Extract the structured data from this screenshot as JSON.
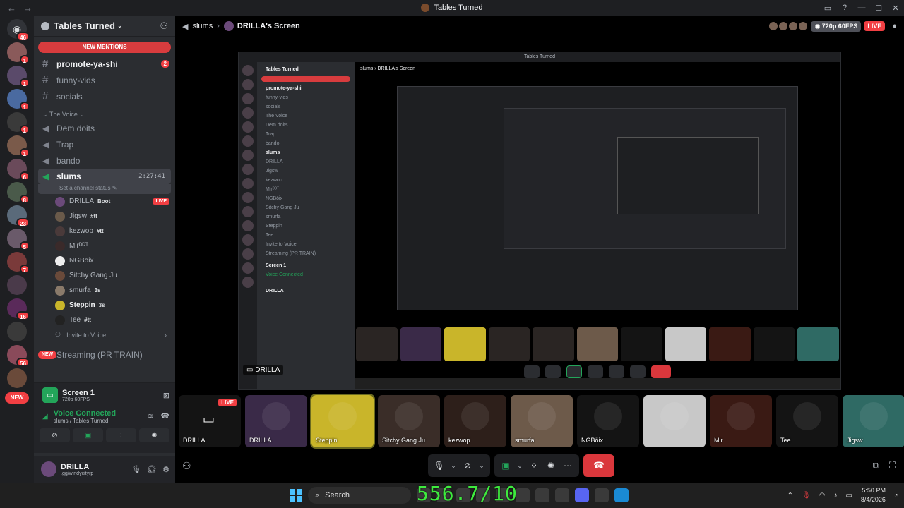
{
  "window": {
    "title": "Tables Turned",
    "back_icon": "arrow-left",
    "forward_icon": "arrow-right"
  },
  "rail": {
    "home_badge": "46",
    "servers": [
      {
        "badge": "1"
      },
      {
        "badge": "1"
      },
      {
        "badge": "1"
      },
      {
        "badge": "1"
      },
      {
        "badge": "1"
      },
      {
        "badge": "6"
      },
      {
        "badge": "8"
      },
      {
        "badge": "23"
      },
      {
        "badge": "5"
      },
      {
        "badge": "7"
      },
      {
        "badge": ""
      },
      {
        "badge": "16"
      },
      {
        "badge": ""
      },
      {
        "badge": "56"
      },
      {
        "badge": ""
      }
    ],
    "new_label": "NEW"
  },
  "sidebar": {
    "guild_name": "Tables Turned",
    "mentions_label": "NEW MENTIONS",
    "text_channels": [
      {
        "name": "promote-ya-shi",
        "count": "2",
        "unread": true
      },
      {
        "name": "funny-vids",
        "count": "",
        "unread": false
      },
      {
        "name": "socials",
        "count": "",
        "unread": false
      }
    ],
    "category": "The Voice",
    "voice_channels": [
      {
        "name": "Dem doits"
      },
      {
        "name": "Trap"
      },
      {
        "name": "bando"
      }
    ],
    "active_channel": {
      "name": "slums",
      "timer": "2:27:41",
      "status": "Set a channel status"
    },
    "users": [
      {
        "name": "DRILLA",
        "tag": "Boot",
        "live": "LIVE",
        "bold": false
      },
      {
        "name": "Jigsw",
        "tag": "#tt",
        "live": "",
        "bold": false
      },
      {
        "name": "kezwop",
        "tag": "#tt",
        "live": "",
        "bold": false
      },
      {
        "name": "Mirᴰᴰᵀ",
        "tag": "",
        "live": "",
        "bold": false
      },
      {
        "name": "NGBöix",
        "tag": "",
        "live": "",
        "bold": false
      },
      {
        "name": "Sitchy Gang Ju",
        "tag": "",
        "live": "",
        "bold": false
      },
      {
        "name": "smurfa",
        "tag": "3s",
        "live": "",
        "bold": false
      },
      {
        "name": "Steppin",
        "tag": "3s",
        "live": "",
        "bold": true
      },
      {
        "name": "Tee",
        "tag": "#tt",
        "live": "",
        "bold": false
      }
    ],
    "invite_label": "Invite to Voice",
    "streaming_channel": "Streaming (PR TRAIN)",
    "new_label": "NEW"
  },
  "screen_panel": {
    "title": "Screen 1",
    "quality": "720p 60FPS"
  },
  "voice_panel": {
    "status": "Voice Connected",
    "location": "slums / Tables Turned"
  },
  "user_panel": {
    "name": "DRILLA",
    "handle": ".gg/windycityrp"
  },
  "stage": {
    "channel": "slums",
    "stream_title": "DRILLA's Screen",
    "quality": "720p 60FPS",
    "live": "LIVE",
    "stream_label": "DRILLA"
  },
  "tiles": [
    {
      "name": "DRILLA",
      "live": "LIVE",
      "color": "#141414",
      "screen": true
    },
    {
      "name": "DRILLA",
      "live": "",
      "color": "#3a2a48",
      "screen": false
    },
    {
      "name": "Steppin",
      "live": "",
      "color": "#c9b52a",
      "screen": false
    },
    {
      "name": "Sitchy Gang Ju",
      "live": "",
      "color": "#3a2d28",
      "screen": false
    },
    {
      "name": "kezwop",
      "live": "",
      "color": "#2d1f1a",
      "screen": false
    },
    {
      "name": "smurfa",
      "live": "",
      "color": "#6d5a4a",
      "screen": false
    },
    {
      "name": "NGBöix",
      "live": "",
      "color": "#141414",
      "screen": false
    },
    {
      "name": "",
      "live": "",
      "color": "#c8c8c8",
      "screen": false
    },
    {
      "name": "Mir",
      "live": "",
      "color": "#3a1a14",
      "screen": false
    },
    {
      "name": "Tee",
      "live": "",
      "color": "#141414",
      "screen": false
    },
    {
      "name": "Jigsw",
      "live": "",
      "color": "#2f6a64",
      "screen": false
    }
  ],
  "taskbar": {
    "search_label": "Search",
    "time": "5:50 PM",
    "date": "8/4/2026"
  },
  "overlay_counter": "556.7/10"
}
